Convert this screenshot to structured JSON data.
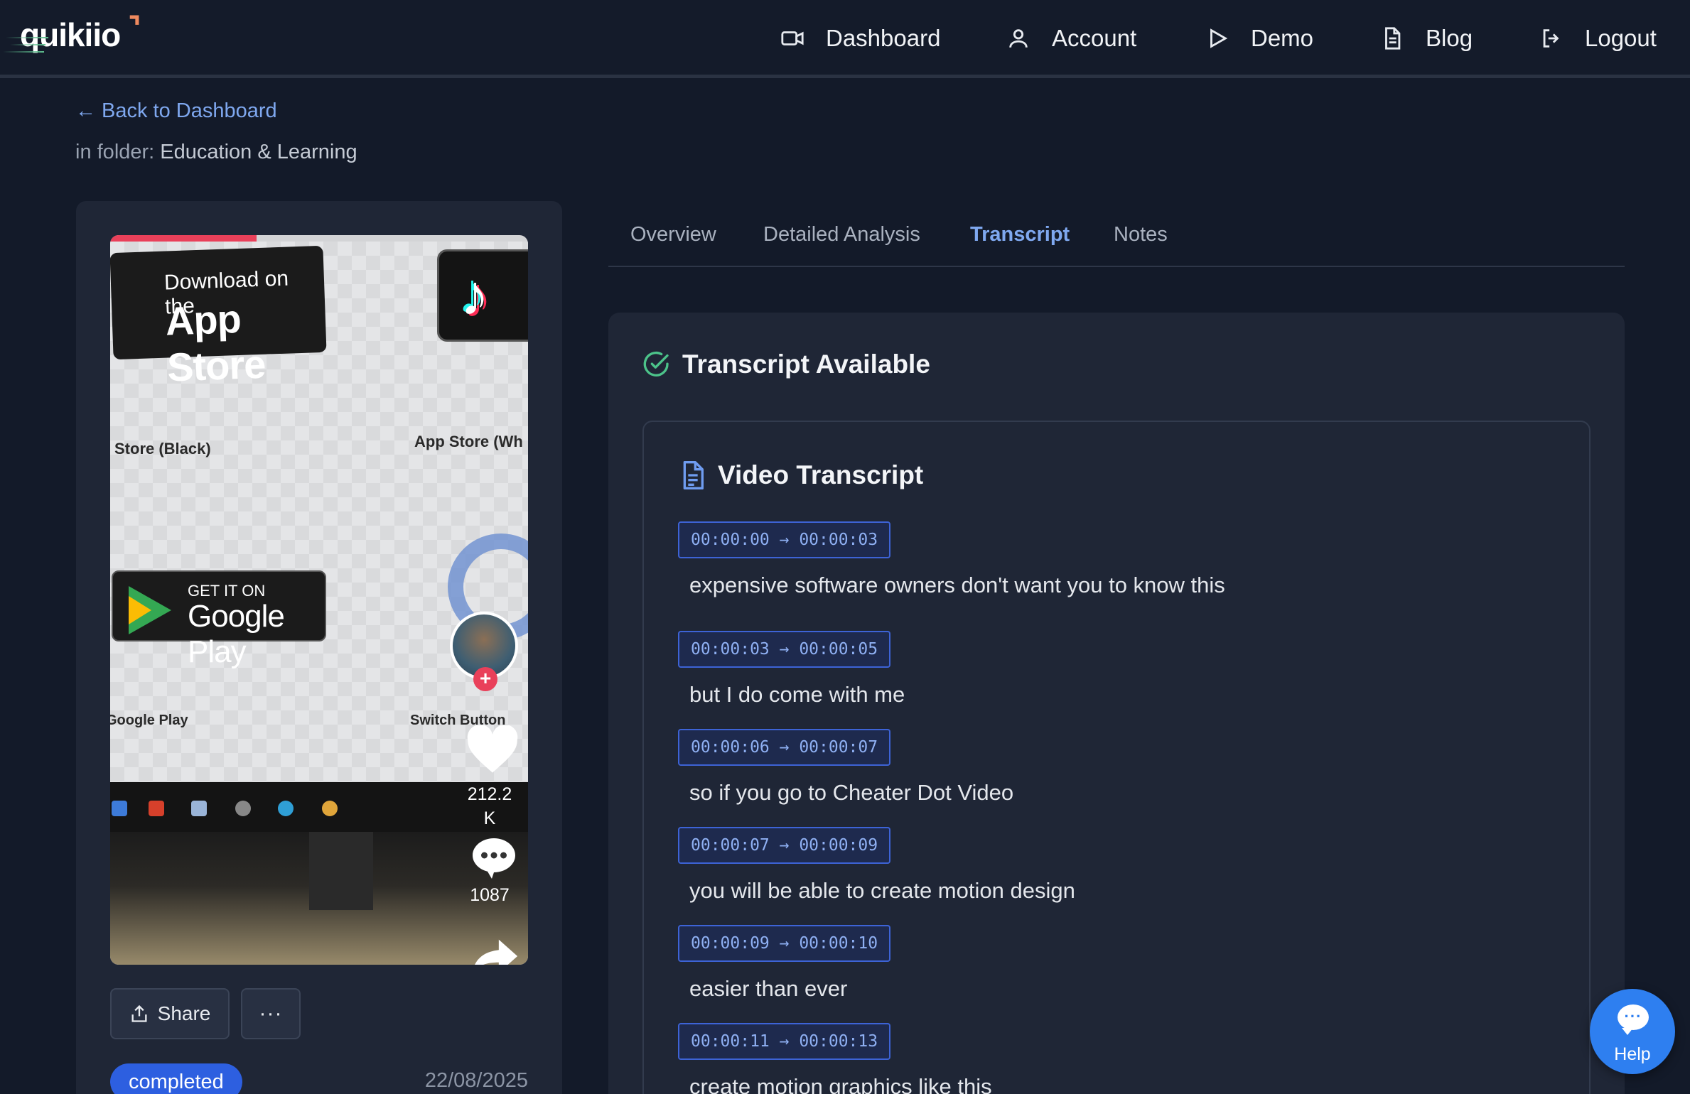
{
  "app": {
    "logo_text": "quikiio"
  },
  "nav": {
    "dashboard": "Dashboard",
    "account": "Account",
    "demo": "Demo",
    "blog": "Blog",
    "logout": "Logout"
  },
  "page": {
    "back_label": "Back to Dashboard",
    "folder_prefix": "in folder:",
    "folder_name": "Education & Learning"
  },
  "video": {
    "overlay_texts": {
      "appstore_small": "Download on the",
      "appstore_big": "App Store",
      "label_store_black": "Store (Black)",
      "label_app_store_white": "App Store (Wh",
      "gplay_small": "GET IT ON",
      "gplay_big": "Google Play",
      "label_google_play": "Google Play",
      "label_switch_button": "Switch Button"
    },
    "likes": "212.2\nK",
    "comments": "1087",
    "share_label": "Share",
    "more_label": "···",
    "status": "completed",
    "date": "22/08/2025",
    "progress_fraction": 0.35
  },
  "tabs": {
    "overview": "Overview",
    "detailed_analysis": "Detailed Analysis",
    "transcript": "Transcript",
    "notes": "Notes",
    "active": "Transcript"
  },
  "transcript": {
    "status_title": "Transcript Available",
    "section_title": "Video Transcript",
    "segments": [
      {
        "time": "00:00:00 → 00:00:03",
        "text": "expensive software owners don't want you to know this"
      },
      {
        "time": "00:00:03 → 00:00:05",
        "text": "but I do come with me"
      },
      {
        "time": "00:00:06 → 00:00:07",
        "text": "so if you go to Cheater Dot Video"
      },
      {
        "time": "00:00:07 → 00:00:09",
        "text": "you will be able to create motion design"
      },
      {
        "time": "00:00:09 → 00:00:10",
        "text": "easier than ever"
      },
      {
        "time": "00:00:11 → 00:00:13",
        "text": "create motion graphics like this"
      }
    ]
  },
  "help": {
    "label": "Help"
  },
  "colors": {
    "background": "#131a29",
    "card": "#1f2636",
    "accent_link": "#7fa8ef",
    "status_badge": "#2d5fe0",
    "success_icon": "#4cc38a",
    "help_button": "#2e7ff0"
  }
}
